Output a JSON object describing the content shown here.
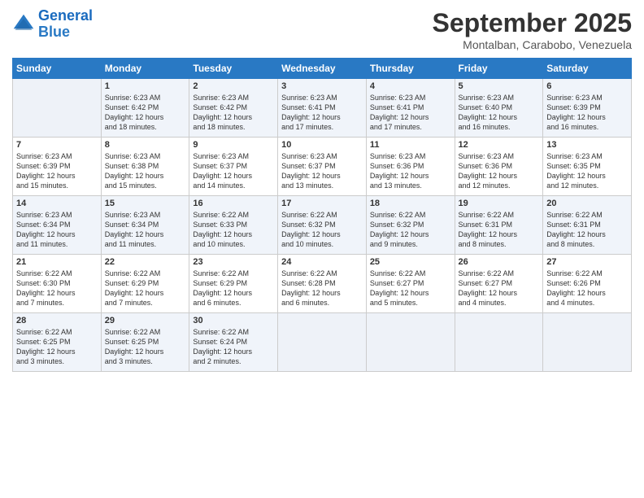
{
  "logo": {
    "line1": "General",
    "line2": "Blue"
  },
  "title": "September 2025",
  "location": "Montalban, Carabobo, Venezuela",
  "days_of_week": [
    "Sunday",
    "Monday",
    "Tuesday",
    "Wednesday",
    "Thursday",
    "Friday",
    "Saturday"
  ],
  "weeks": [
    [
      {
        "day": "",
        "info": ""
      },
      {
        "day": "1",
        "info": "Sunrise: 6:23 AM\nSunset: 6:42 PM\nDaylight: 12 hours\nand 18 minutes."
      },
      {
        "day": "2",
        "info": "Sunrise: 6:23 AM\nSunset: 6:42 PM\nDaylight: 12 hours\nand 18 minutes."
      },
      {
        "day": "3",
        "info": "Sunrise: 6:23 AM\nSunset: 6:41 PM\nDaylight: 12 hours\nand 17 minutes."
      },
      {
        "day": "4",
        "info": "Sunrise: 6:23 AM\nSunset: 6:41 PM\nDaylight: 12 hours\nand 17 minutes."
      },
      {
        "day": "5",
        "info": "Sunrise: 6:23 AM\nSunset: 6:40 PM\nDaylight: 12 hours\nand 16 minutes."
      },
      {
        "day": "6",
        "info": "Sunrise: 6:23 AM\nSunset: 6:39 PM\nDaylight: 12 hours\nand 16 minutes."
      }
    ],
    [
      {
        "day": "7",
        "info": "Sunrise: 6:23 AM\nSunset: 6:39 PM\nDaylight: 12 hours\nand 15 minutes."
      },
      {
        "day": "8",
        "info": "Sunrise: 6:23 AM\nSunset: 6:38 PM\nDaylight: 12 hours\nand 15 minutes."
      },
      {
        "day": "9",
        "info": "Sunrise: 6:23 AM\nSunset: 6:37 PM\nDaylight: 12 hours\nand 14 minutes."
      },
      {
        "day": "10",
        "info": "Sunrise: 6:23 AM\nSunset: 6:37 PM\nDaylight: 12 hours\nand 13 minutes."
      },
      {
        "day": "11",
        "info": "Sunrise: 6:23 AM\nSunset: 6:36 PM\nDaylight: 12 hours\nand 13 minutes."
      },
      {
        "day": "12",
        "info": "Sunrise: 6:23 AM\nSunset: 6:36 PM\nDaylight: 12 hours\nand 12 minutes."
      },
      {
        "day": "13",
        "info": "Sunrise: 6:23 AM\nSunset: 6:35 PM\nDaylight: 12 hours\nand 12 minutes."
      }
    ],
    [
      {
        "day": "14",
        "info": "Sunrise: 6:23 AM\nSunset: 6:34 PM\nDaylight: 12 hours\nand 11 minutes."
      },
      {
        "day": "15",
        "info": "Sunrise: 6:23 AM\nSunset: 6:34 PM\nDaylight: 12 hours\nand 11 minutes."
      },
      {
        "day": "16",
        "info": "Sunrise: 6:22 AM\nSunset: 6:33 PM\nDaylight: 12 hours\nand 10 minutes."
      },
      {
        "day": "17",
        "info": "Sunrise: 6:22 AM\nSunset: 6:32 PM\nDaylight: 12 hours\nand 10 minutes."
      },
      {
        "day": "18",
        "info": "Sunrise: 6:22 AM\nSunset: 6:32 PM\nDaylight: 12 hours\nand 9 minutes."
      },
      {
        "day": "19",
        "info": "Sunrise: 6:22 AM\nSunset: 6:31 PM\nDaylight: 12 hours\nand 8 minutes."
      },
      {
        "day": "20",
        "info": "Sunrise: 6:22 AM\nSunset: 6:31 PM\nDaylight: 12 hours\nand 8 minutes."
      }
    ],
    [
      {
        "day": "21",
        "info": "Sunrise: 6:22 AM\nSunset: 6:30 PM\nDaylight: 12 hours\nand 7 minutes."
      },
      {
        "day": "22",
        "info": "Sunrise: 6:22 AM\nSunset: 6:29 PM\nDaylight: 12 hours\nand 7 minutes."
      },
      {
        "day": "23",
        "info": "Sunrise: 6:22 AM\nSunset: 6:29 PM\nDaylight: 12 hours\nand 6 minutes."
      },
      {
        "day": "24",
        "info": "Sunrise: 6:22 AM\nSunset: 6:28 PM\nDaylight: 12 hours\nand 6 minutes."
      },
      {
        "day": "25",
        "info": "Sunrise: 6:22 AM\nSunset: 6:27 PM\nDaylight: 12 hours\nand 5 minutes."
      },
      {
        "day": "26",
        "info": "Sunrise: 6:22 AM\nSunset: 6:27 PM\nDaylight: 12 hours\nand 4 minutes."
      },
      {
        "day": "27",
        "info": "Sunrise: 6:22 AM\nSunset: 6:26 PM\nDaylight: 12 hours\nand 4 minutes."
      }
    ],
    [
      {
        "day": "28",
        "info": "Sunrise: 6:22 AM\nSunset: 6:25 PM\nDaylight: 12 hours\nand 3 minutes."
      },
      {
        "day": "29",
        "info": "Sunrise: 6:22 AM\nSunset: 6:25 PM\nDaylight: 12 hours\nand 3 minutes."
      },
      {
        "day": "30",
        "info": "Sunrise: 6:22 AM\nSunset: 6:24 PM\nDaylight: 12 hours\nand 2 minutes."
      },
      {
        "day": "",
        "info": ""
      },
      {
        "day": "",
        "info": ""
      },
      {
        "day": "",
        "info": ""
      },
      {
        "day": "",
        "info": ""
      }
    ]
  ]
}
